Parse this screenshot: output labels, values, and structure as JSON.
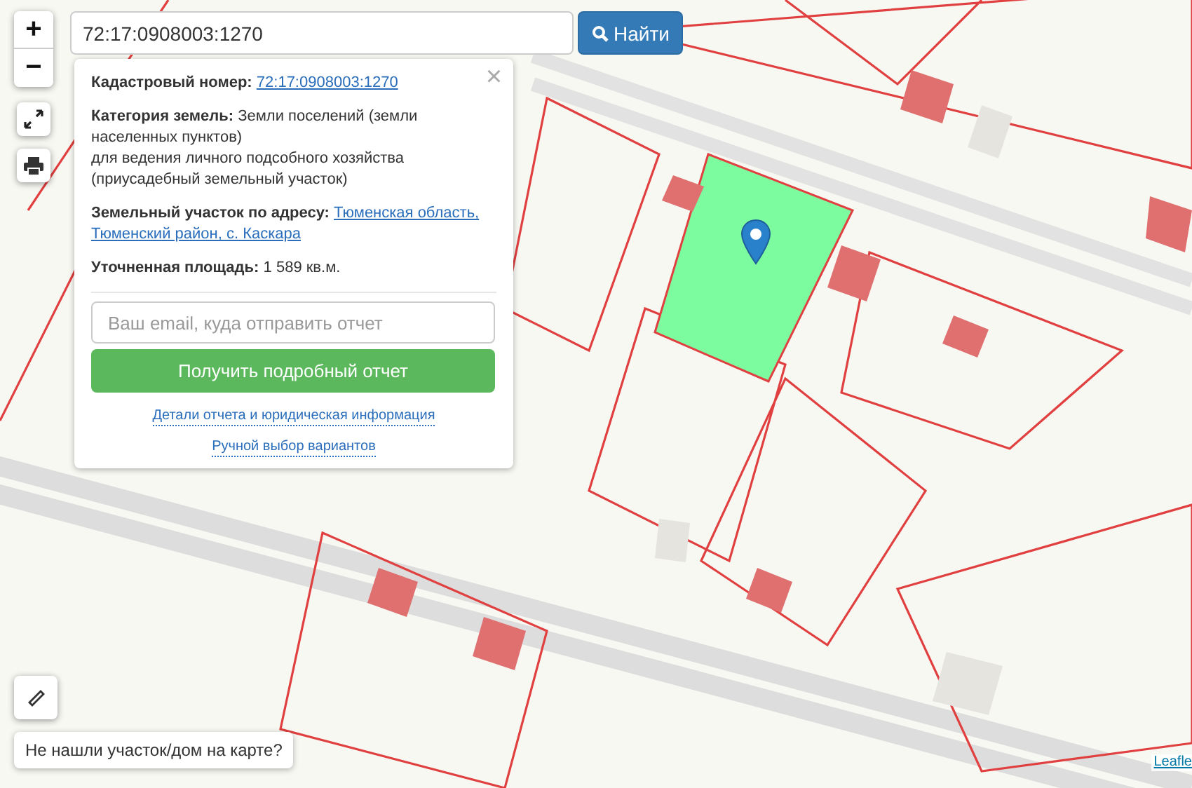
{
  "zoom": {
    "in": "+",
    "out": "−"
  },
  "search": {
    "value": "72:17:0908003:1270",
    "button": "Найти"
  },
  "popup": {
    "close": "×",
    "fields": [
      {
        "kind": "link",
        "label": "Кадастровый номер:",
        "value": "72:17:0908003:1270"
      },
      {
        "kind": "text",
        "label": "Категория земель:",
        "value": "Земли поселений (земли населенных пунктов)",
        "extra": "для ведения личного подсобного хозяйства (приусадебный земельный участок)"
      },
      {
        "kind": "link",
        "label": "Земельный участок по адресу:",
        "value": [
          "Тюменская область,",
          "Тюменский район, с. Каскара"
        ]
      },
      {
        "kind": "text",
        "label": "Уточненная площадь:",
        "value": "1 589 кв.м."
      }
    ],
    "email_placeholder": "Ваш email, куда отправить отчет",
    "submit": "Получить подробный отчет",
    "links": [
      "Детали отчета и юридическая информация",
      "Ручной выбор вариантов"
    ]
  },
  "not_found_button": "Не нашли участок/дом на карте?",
  "attribution": "Leafle"
}
